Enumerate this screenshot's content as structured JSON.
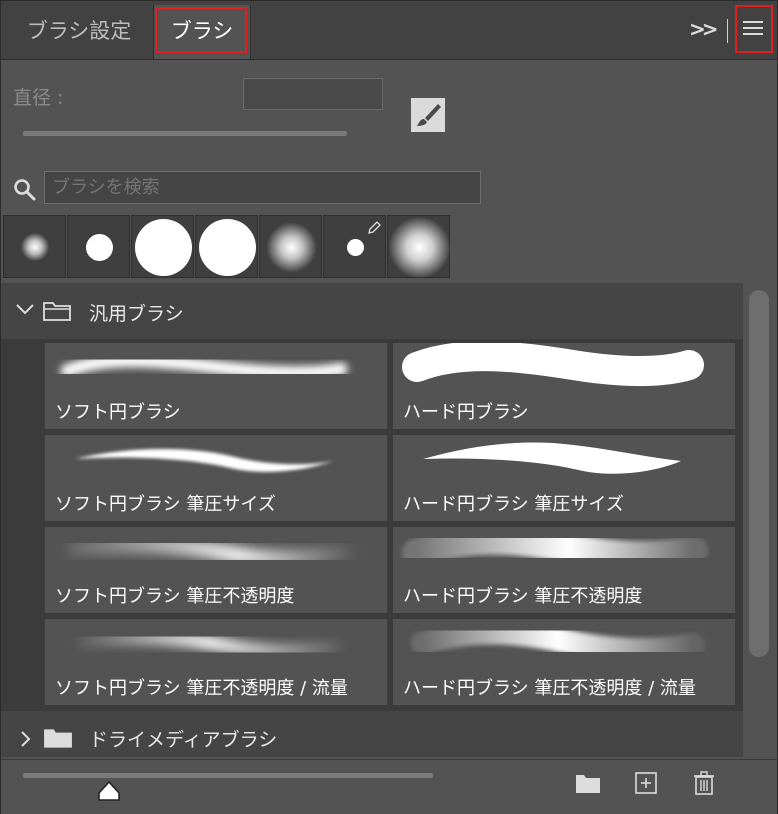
{
  "tabs": [
    {
      "label": "ブラシ設定",
      "active": false
    },
    {
      "label": "ブラシ",
      "active": true
    }
  ],
  "header": {
    "expand_label": "»"
  },
  "diameter": {
    "label": "直径 :",
    "value": ""
  },
  "search": {
    "placeholder": "ブラシを検索",
    "value": ""
  },
  "recent_brushes": [
    {
      "kind": "soft",
      "size": "small"
    },
    {
      "kind": "hard",
      "size": "medium"
    },
    {
      "kind": "hard",
      "size": "large"
    },
    {
      "kind": "hard",
      "size": "large"
    },
    {
      "kind": "soft",
      "size": "medium"
    },
    {
      "kind": "hard",
      "size": "small",
      "pencil": true
    },
    {
      "kind": "soft",
      "size": "large"
    }
  ],
  "groups": [
    {
      "title": "汎用ブラシ",
      "expanded": true,
      "brushes": [
        "ソフト円ブラシ",
        "ハード円ブラシ",
        "ソフト円ブラシ 筆圧サイズ",
        "ハード円ブラシ 筆圧サイズ",
        "ソフト円ブラシ 筆圧不透明度",
        "ハード円ブラシ 筆圧不透明度",
        "ソフト円ブラシ 筆圧不透明度 / 流量",
        "ハード円ブラシ 筆圧不透明度 / 流量"
      ]
    },
    {
      "title": "ドライメディアブラシ",
      "expanded": false
    }
  ],
  "colors": {
    "highlight": "#e02020",
    "panel": "#535353",
    "list": "#3b3b3b"
  }
}
